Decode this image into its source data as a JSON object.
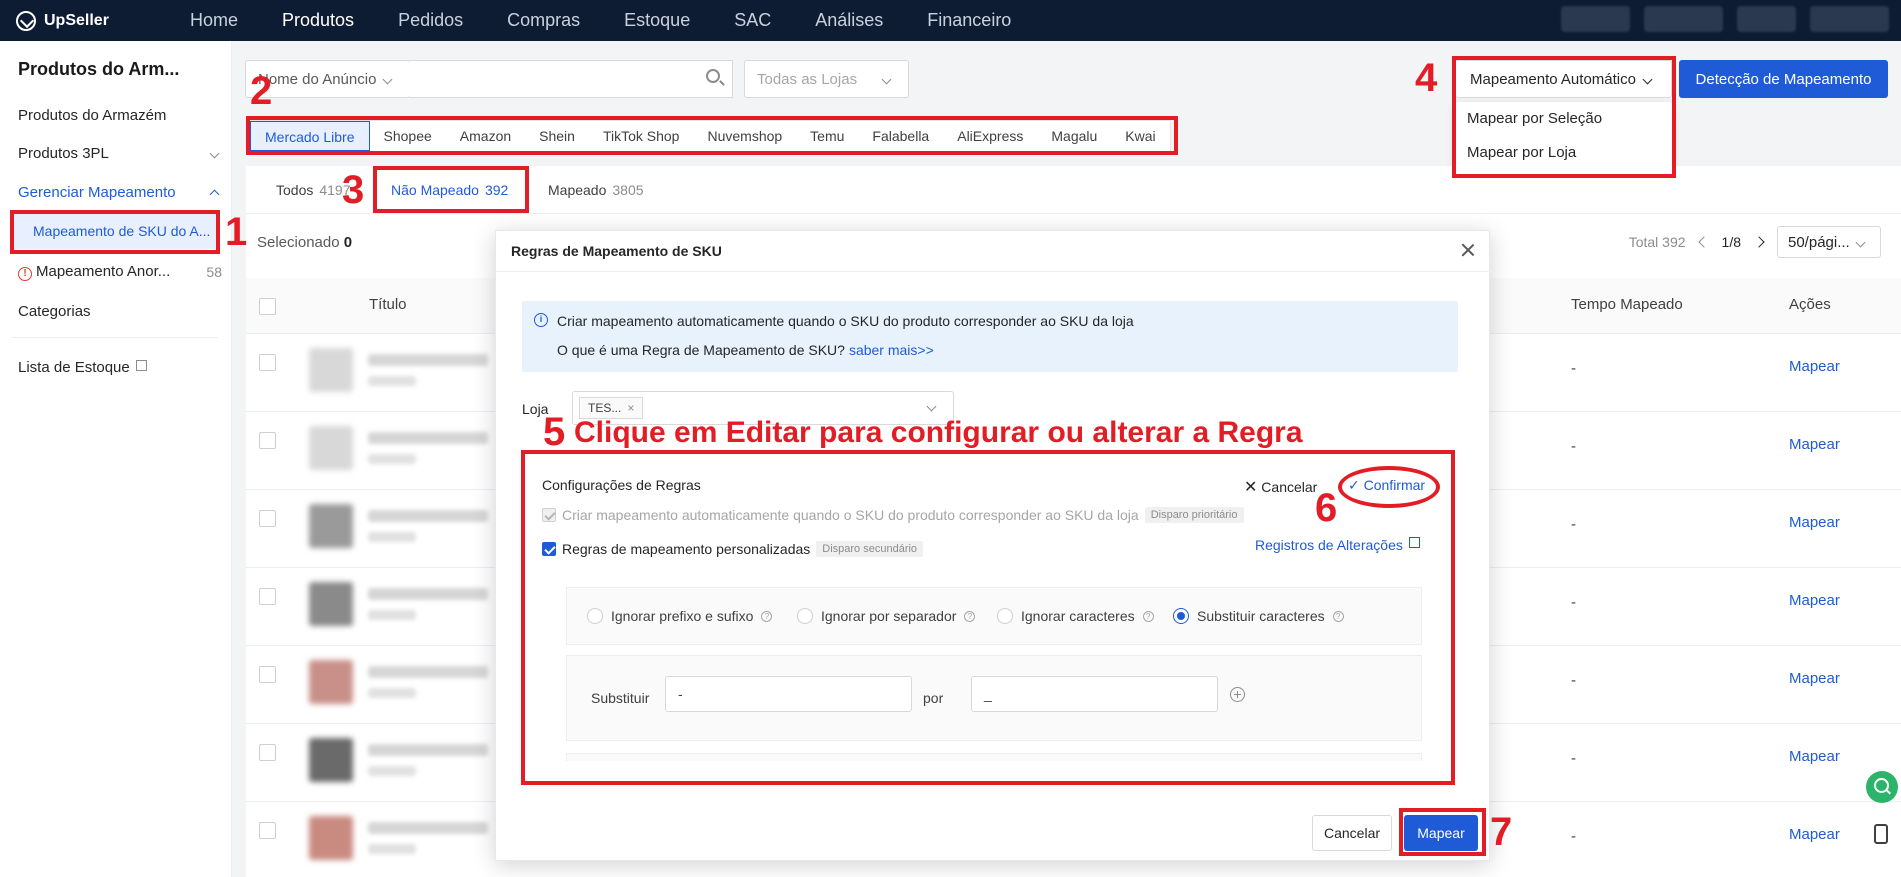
{
  "app": {
    "logo": "UpSeller"
  },
  "nav": {
    "items": [
      "Home",
      "Produtos",
      "Pedidos",
      "Compras",
      "Estoque",
      "SAC",
      "Análises",
      "Financeiro"
    ],
    "active": "Produtos"
  },
  "sidebar": {
    "title": "Produtos do Arm...",
    "items": {
      "armazem": "Produtos do Armazém",
      "p3pl": "Produtos 3PL",
      "gerenciar": "Gerenciar Mapeamento",
      "sku_map": "Mapeamento de SKU do A...",
      "anormal": "Mapeamento Anor...",
      "anormal_count": "58",
      "categorias": "Categorias",
      "lista_estoque": "Lista de Estoque"
    }
  },
  "filters": {
    "field_select": "Nome do Anúncio",
    "search_value": "",
    "store_select": "Todas as Lojas"
  },
  "toolbar": {
    "auto_map": "Mapeamento Automático",
    "detect": "Detecção de Mapeamento",
    "menu": [
      "Mapear por Seleção",
      "Mapear por Loja"
    ]
  },
  "marketplaces": [
    "Mercado Libre",
    "Shopee",
    "Amazon",
    "Shein",
    "TikTok Shop",
    "Nuvemshop",
    "Temu",
    "Falabella",
    "AliExpress",
    "Magalu",
    "Kwai"
  ],
  "status_tabs": [
    {
      "label": "Todos",
      "count": "4197"
    },
    {
      "label": "Não Mapeado",
      "count": "392"
    },
    {
      "label": "Mapeado",
      "count": "3805"
    }
  ],
  "selection": {
    "label": "Selecionado",
    "count": "0"
  },
  "pager": {
    "total": "Total 392",
    "page": "1/8",
    "size": "50/pági..."
  },
  "table": {
    "headers": {
      "title": "Título",
      "mapped_time": "Tempo Mapeado",
      "actions": "Ações"
    },
    "dash": "-",
    "action": "Mapear"
  },
  "modal": {
    "title": "Regras de Mapeamento de SKU",
    "info_line1": "Criar mapeamento automaticamente quando o SKU do produto corresponder ao SKU da loja",
    "info_line2": "O que é uma Regra de Mapeamento de SKU?",
    "info_link": "saber mais>>",
    "loja_label": "Loja",
    "loja_tag": "TES...",
    "rules_title": "Configurações de Regras",
    "cancel_edit": "Cancelar",
    "confirm_edit": "Confirmar",
    "rule1": "Criar mapeamento automaticamente quando o SKU do produto corresponder ao SKU da loja",
    "rule1_tag": "Disparo prioritário",
    "rule2": "Regras de mapeamento personalizadas",
    "rule2_tag": "Disparo secundário",
    "changes_link": "Registros de Alterações",
    "options": [
      "Ignorar prefixo e sufixo",
      "Ignorar por separador",
      "Ignorar caracteres",
      "Substituir caracteres"
    ],
    "subst_label": "Substituir",
    "subst_from": "-",
    "por_label": "por",
    "subst_to": "_",
    "btn_cancel": "Cancelar",
    "btn_map": "Mapear"
  },
  "annotations": {
    "n1": "1",
    "n2": "2",
    "n3": "3",
    "n4": "4",
    "n5": "5",
    "n6": "6",
    "n7": "7",
    "step5_text": "Clique em Editar para configurar ou alterar a Regra",
    "color": "#e21d25"
  }
}
